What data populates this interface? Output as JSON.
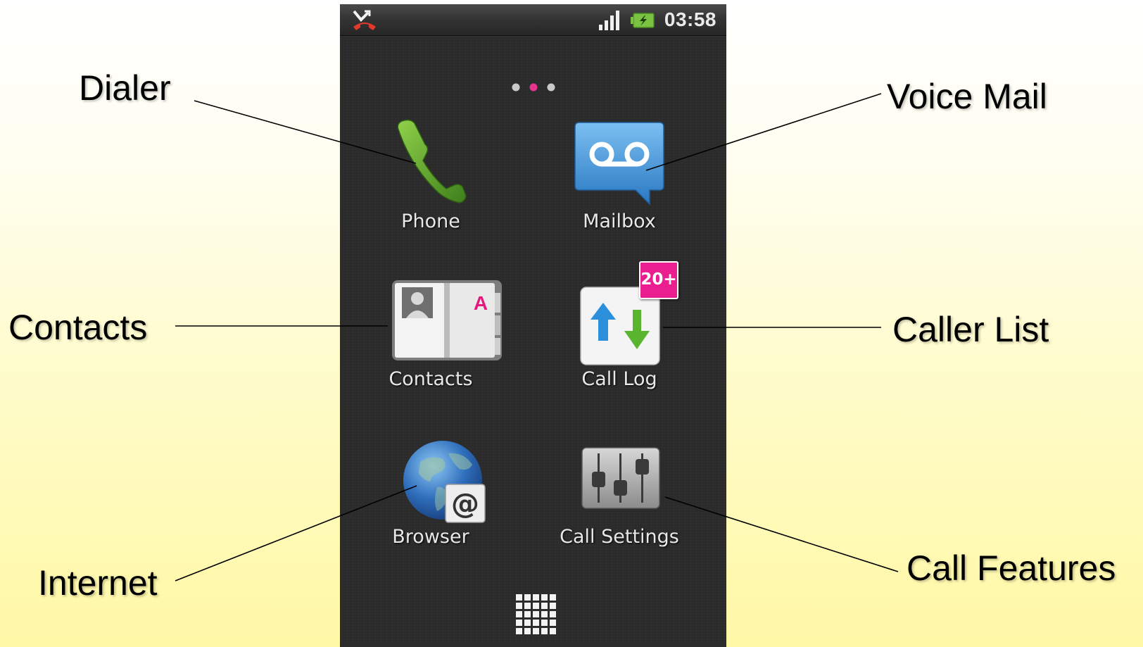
{
  "status_bar": {
    "time": "03:58",
    "icons": [
      "missed-call-icon",
      "signal-icon",
      "battery-charging-icon"
    ]
  },
  "page_indicator": {
    "pages": 3,
    "active": 2
  },
  "apps": [
    {
      "label": "Phone",
      "icon": "phone-icon",
      "callout": "Dialer"
    },
    {
      "label": "Mailbox",
      "icon": "voicemail-icon",
      "callout": "Voice Mail"
    },
    {
      "label": "Contacts",
      "icon": "contacts-book-icon",
      "callout": "Contacts"
    },
    {
      "label": "Call Log",
      "icon": "call-log-icon",
      "callout": "Caller List",
      "badge": "20+"
    },
    {
      "label": "Browser",
      "icon": "globe-icon",
      "callout": "Internet"
    },
    {
      "label": "Call Settings",
      "icon": "sliders-icon",
      "callout": "Call Features"
    }
  ],
  "app_drawer": {
    "icon": "app-grid-icon"
  },
  "colors": {
    "badge": "#ea1e8e",
    "active_dot": "#e8338f",
    "phone_green": "#5aa02c",
    "mail_blue": "#3d92d6"
  }
}
